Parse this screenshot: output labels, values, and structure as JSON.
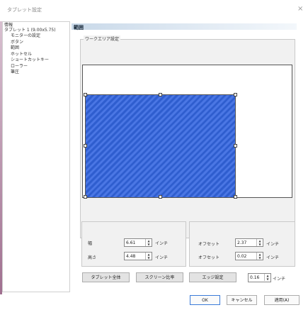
{
  "window": {
    "title": "タブレット設定",
    "close_glyph": "×"
  },
  "sidebar": {
    "items": [
      {
        "label": "情報",
        "level": 0
      },
      {
        "label": "タブレット 1 (9.00x5.75)",
        "level": 0
      },
      {
        "label": "モニターの設定",
        "level": 1
      },
      {
        "label": "ボタン",
        "level": 1
      },
      {
        "label": "範囲",
        "level": 1
      },
      {
        "label": "ホットセル",
        "level": 1
      },
      {
        "label": "ショートカットキー",
        "level": 1
      },
      {
        "label": "ローラー",
        "level": 1
      },
      {
        "label": "筆圧",
        "level": 1
      }
    ]
  },
  "section": {
    "title": "範囲"
  },
  "workarea_group": {
    "label": "ワークエリア設定"
  },
  "size": {
    "width_label": "幅",
    "width_value": "6.61",
    "height_label": "高さ",
    "height_value": "4.48",
    "unit": "インチ"
  },
  "offset": {
    "x_label": "オフセット",
    "x_value": "2.37",
    "y_label": "オフセット",
    "y_value": "0.02",
    "unit": "インチ"
  },
  "buttons": {
    "tablet_full": "タブレット全体",
    "screen_ratio": "スクリーン比率",
    "edge_settings": "エッジ設定",
    "edge_value": "0.16",
    "edge_unit": "インチ"
  },
  "footer": {
    "ok": "OK",
    "cancel": "キャンセル",
    "apply": "適用(A)"
  },
  "colors": {
    "workarea_fill": "#3a66d6",
    "section_header": "#c9d9e9"
  }
}
